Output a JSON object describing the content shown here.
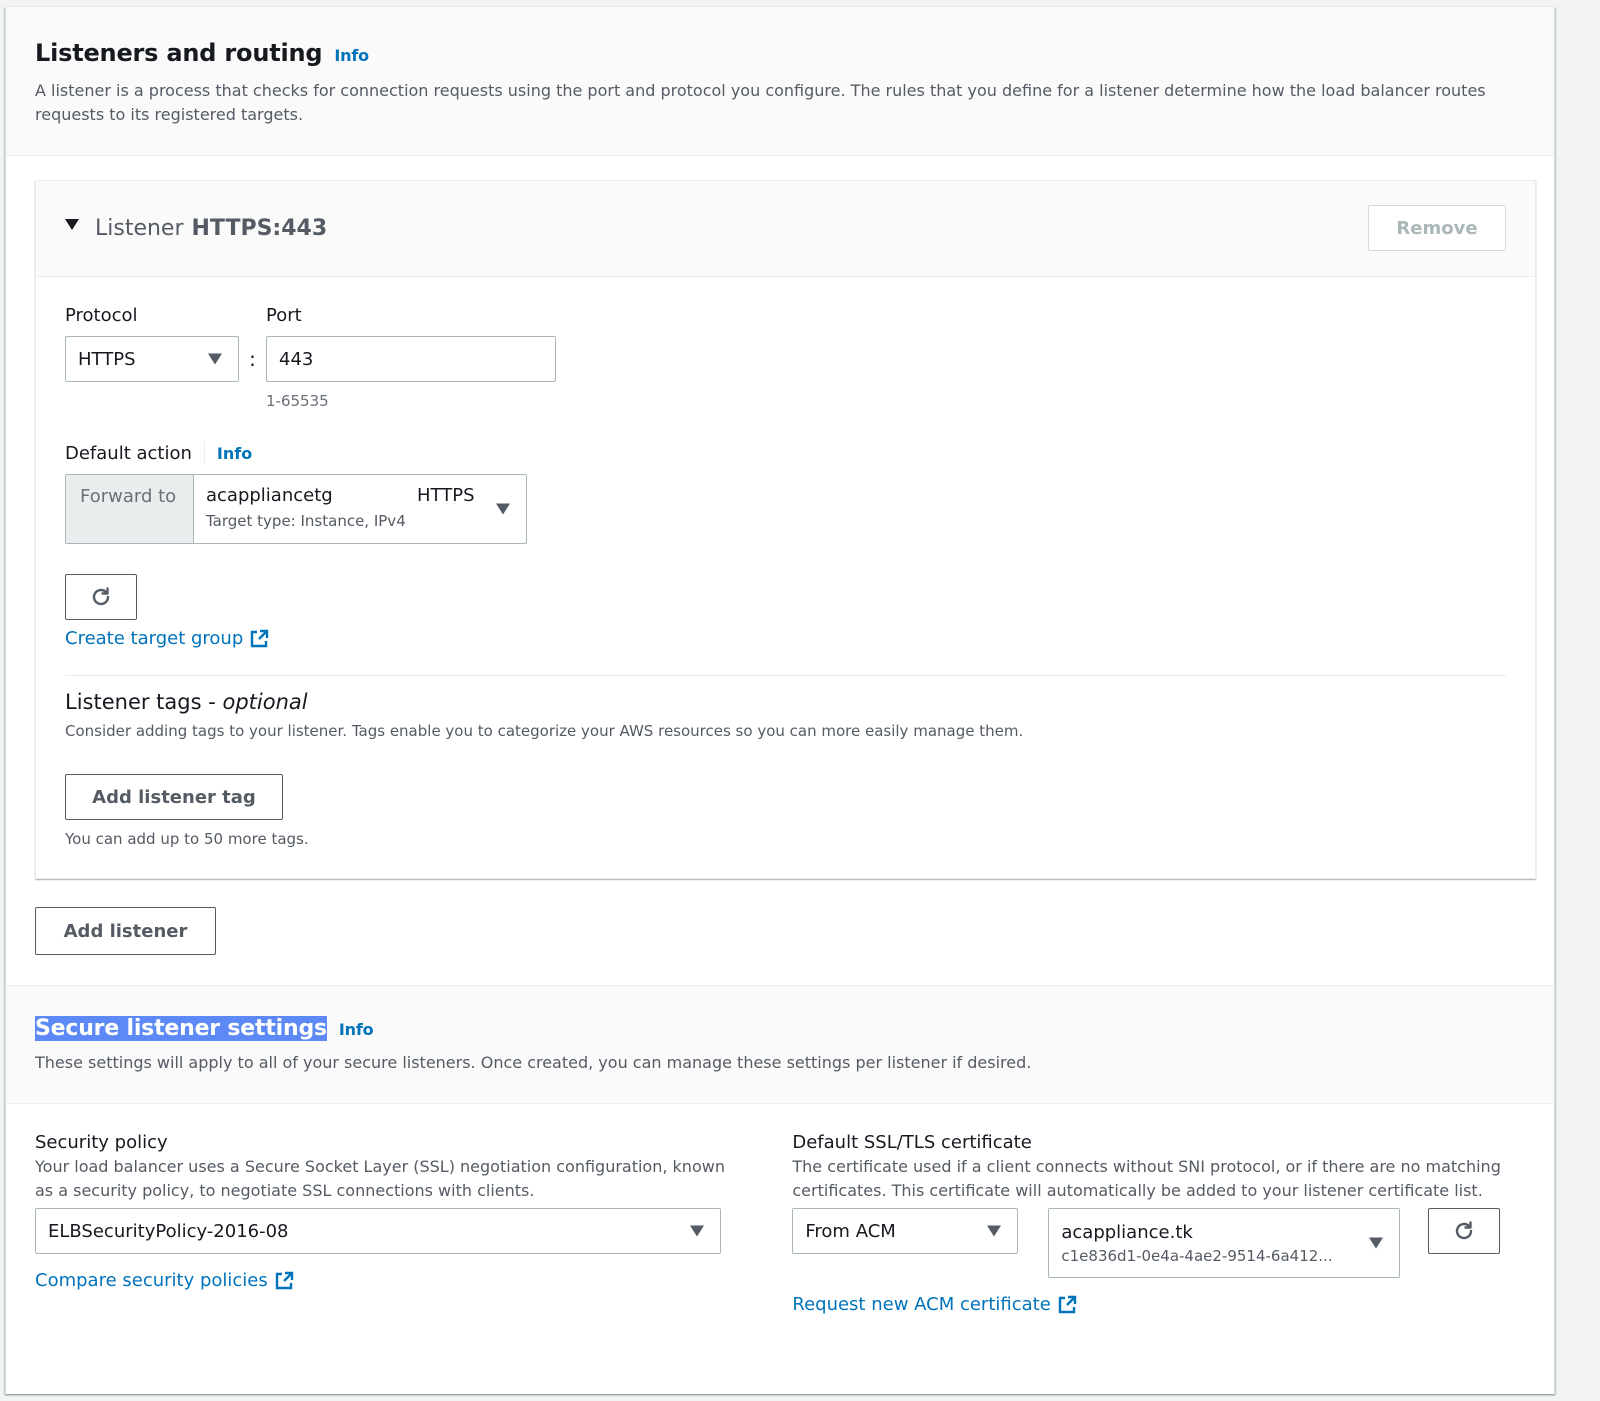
{
  "listeners_section": {
    "title": "Listeners and routing",
    "info": "Info",
    "description": "A listener is a process that checks for connection requests using the port and protocol you configure. The rules that you define for a listener determine how the load balancer routes requests to its registered targets."
  },
  "listener": {
    "label": "Listener",
    "name": "HTTPS:443",
    "remove_label": "Remove",
    "protocol_label": "Protocol",
    "protocol_value": "HTTPS",
    "port_separator": ":",
    "port_label": "Port",
    "port_value": "443",
    "port_constraint": "1-65535",
    "default_action_label": "Default action",
    "default_action_info": "Info",
    "forward_label": "Forward to",
    "target_group_name": "acappliancetg",
    "target_group_protocol": "HTTPS",
    "target_group_sub": "Target type: Instance, IPv4",
    "create_target_group": "Create target group",
    "tags_title": "Listener tags - ",
    "tags_title_optional": "optional",
    "tags_description": "Consider adding tags to your listener. Tags enable you to categorize your AWS resources so you can more easily manage them.",
    "add_tag_label": "Add listener tag",
    "tags_constraint": "You can add up to 50 more tags."
  },
  "add_listener_label": "Add listener",
  "secure_section": {
    "title": "Secure listener settings",
    "info": "Info",
    "description": "These settings will apply to all of your secure listeners. Once created, you can manage these settings per listener if desired."
  },
  "security_policy": {
    "label": "Security policy",
    "description": "Your load balancer uses a Secure Socket Layer (SSL) negotiation configuration, known as a security policy, to negotiate SSL connections with clients.",
    "value": "ELBSecurityPolicy-2016-08",
    "compare_link": "Compare security policies"
  },
  "certificate": {
    "label": "Default SSL/TLS certificate",
    "description": "The certificate used if a client connects without SNI protocol, or if there are no matching certificates. This certificate will automatically be added to your listener certificate list.",
    "source_value": "From ACM",
    "cert_name": "acappliance.tk",
    "cert_id": "c1e836d1-0e4a-4ae2-9514-6a412...",
    "request_link": "Request new ACM certificate"
  },
  "colors": {
    "link": "#0073bb",
    "highlight": "#5c89f5"
  }
}
